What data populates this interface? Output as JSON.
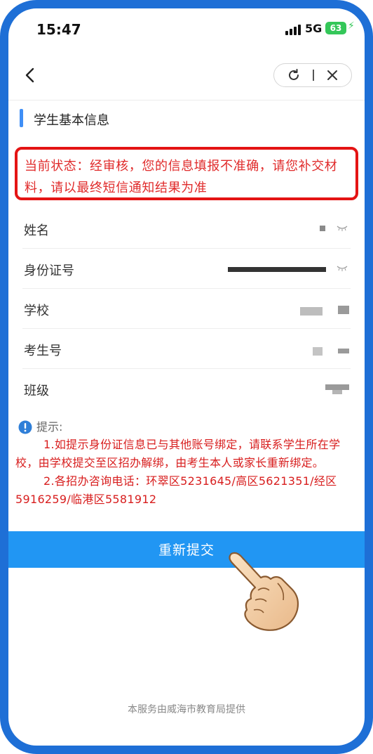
{
  "status_bar": {
    "time": "15:47",
    "network": "5G",
    "battery": "63"
  },
  "section": {
    "title": "学生基本信息"
  },
  "status_notice": {
    "text": "当前状态：经审核，您的信息填报不准确，请您补交材料，请以最终短信通知结果为准"
  },
  "info_rows": [
    {
      "label": "姓名"
    },
    {
      "label": "身份证号"
    },
    {
      "label": "学校"
    },
    {
      "label": "考生号"
    },
    {
      "label": "班级"
    }
  ],
  "tips": {
    "title": "提示:",
    "items": [
      "1.如提示身份证信息已与其他账号绑定，请联系学生所在学校，由学校提交至区招办解绑，由考生本人或家长重新绑定。",
      "2.各招办咨询电话：环翠区5231645/高区5621351/经区5916259/临港区5581912"
    ]
  },
  "resubmit_label": "重新提交",
  "footer": "本服务由威海市教育局提供",
  "colors": {
    "frame": "#1e6fd6",
    "accent": "#3f8ff6",
    "alert": "#e41414",
    "button": "#2196f3"
  }
}
